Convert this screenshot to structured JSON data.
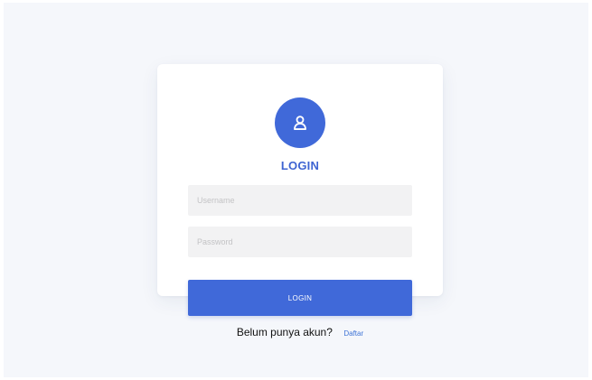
{
  "login_form": {
    "title": "LOGIN",
    "username_placeholder": "Username",
    "password_placeholder": "Password",
    "submit_label": "LOGIN"
  },
  "register": {
    "prompt": "Belum punya akun?",
    "link_label": "Daftar"
  },
  "icons": {
    "avatar": "user-icon"
  },
  "colors": {
    "accent": "#4069d9",
    "page_background": "#f5f7fb",
    "input_background": "#f2f2f3",
    "link": "#3f74d6"
  }
}
